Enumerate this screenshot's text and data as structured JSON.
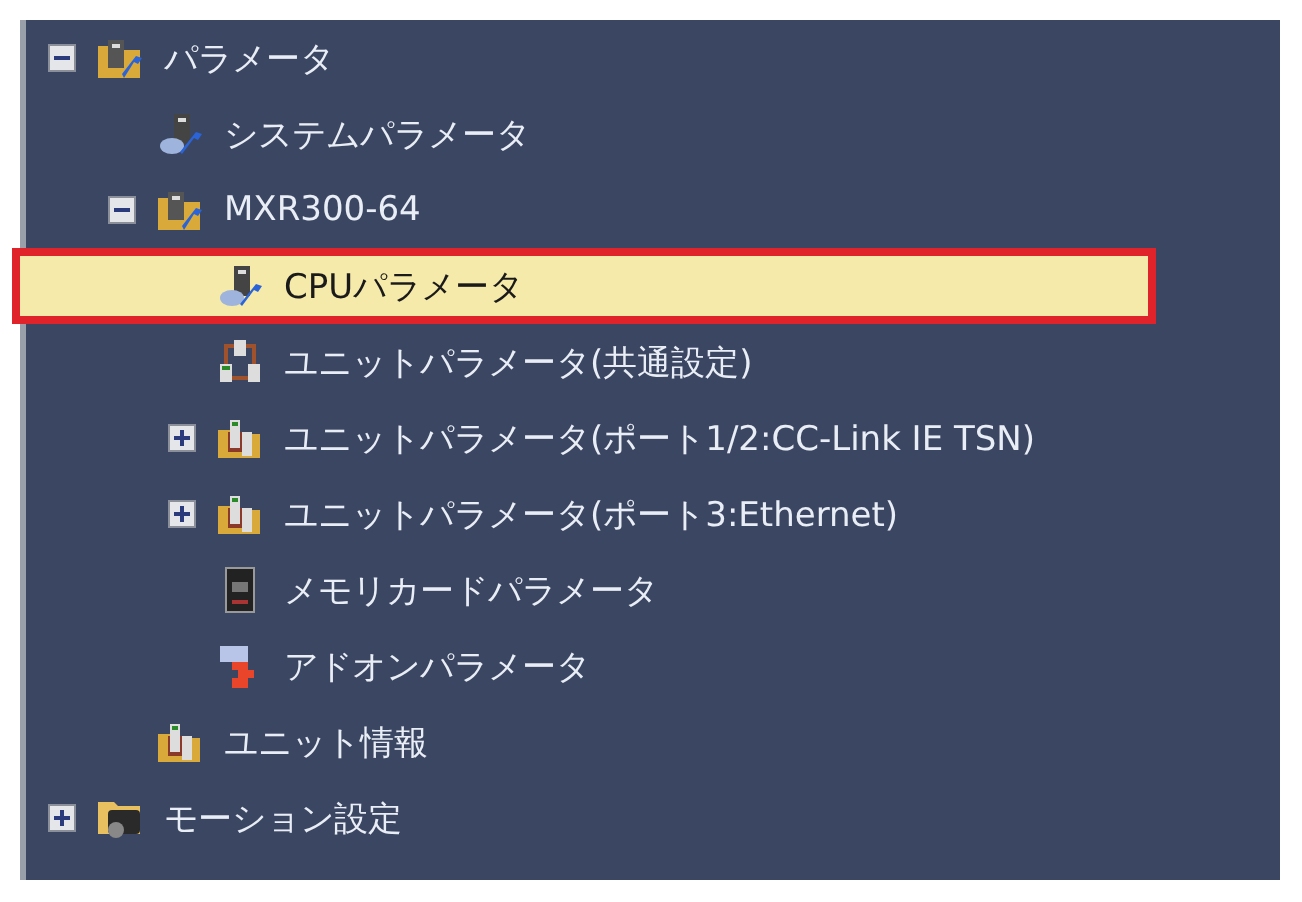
{
  "tree": [
    {
      "label": "パラメータ",
      "kind": "folder-wrench",
      "expanded": true,
      "selected": false,
      "children": [
        {
          "label": "システムパラメータ",
          "kind": "pc-wrench",
          "selected": false
        },
        {
          "label": "MXR300-64",
          "kind": "folder-wrench",
          "expanded": true,
          "selected": false,
          "children": [
            {
              "label": "CPUパラメータ",
              "kind": "pc-wrench",
              "selected": true
            },
            {
              "label": "ユニットパラメータ(共通設定)",
              "kind": "units",
              "selected": false
            },
            {
              "label": "ユニットパラメータ(ポート1/2:CC-Link IE TSN)",
              "kind": "folder-units",
              "expanded": false,
              "selected": false
            },
            {
              "label": "ユニットパラメータ(ポート3:Ethernet)",
              "kind": "folder-units",
              "expanded": false,
              "selected": false
            },
            {
              "label": "メモリカードパラメータ",
              "kind": "memory-card",
              "selected": false
            },
            {
              "label": "アドオンパラメータ",
              "kind": "puzzle",
              "selected": false
            }
          ]
        },
        {
          "label": "ユニット情報",
          "kind": "folder-unit",
          "selected": false
        }
      ]
    },
    {
      "label": "モーション設定",
      "kind": "folder-motor",
      "expanded": false,
      "selected": false
    }
  ]
}
